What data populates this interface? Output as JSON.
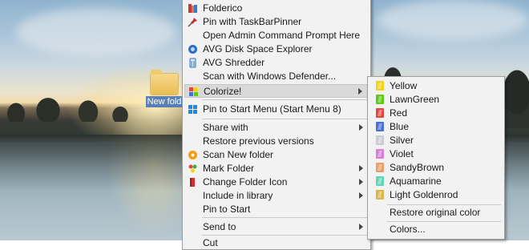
{
  "desktop": {
    "icon_label": "New fold"
  },
  "context_menu": {
    "items": [
      {
        "label": "Folderico",
        "icon": "folderico-icon",
        "icon_color": "#c23b3b"
      },
      {
        "label": "Pin with TaskBarPinner",
        "icon": "pin-icon",
        "icon_color": "#cc2a2a"
      },
      {
        "label": "Open Admin Command Prompt Here",
        "icon": "",
        "icon_color": ""
      },
      {
        "label": "AVG Disk Space Explorer",
        "icon": "avg-disk-icon",
        "icon_color": "#2a6fc9"
      },
      {
        "label": "AVG Shredder",
        "icon": "avg-shredder-icon",
        "icon_color": "#2a6fc9"
      },
      {
        "label": "Scan with Windows Defender...",
        "icon": "",
        "icon_color": ""
      },
      {
        "label": "Colorize!",
        "icon": "colorize-icon",
        "icon_color": "#e09a3a",
        "submenu": true,
        "highlighted": true
      },
      {
        "label": "Pin to Start Menu (Start Menu 8)",
        "icon": "windows-logo-icon",
        "icon_color": "#1e88e5"
      },
      {
        "label": "Share with",
        "icon": "",
        "icon_color": "",
        "submenu": true
      },
      {
        "label": "Restore previous versions",
        "icon": "",
        "icon_color": ""
      },
      {
        "label": "Scan New folder",
        "icon": "avast-icon",
        "icon_color": "#f39c12"
      },
      {
        "label": "Mark Folder",
        "icon": "mark-folder-icon",
        "icon_color": "#3fae49",
        "submenu": true
      },
      {
        "label": "Change Folder Icon",
        "icon": "change-folder-icon",
        "icon_color": "#d32f2f",
        "submenu": true
      },
      {
        "label": "Include in library",
        "icon": "",
        "icon_color": "",
        "submenu": true
      },
      {
        "label": "Pin to Start",
        "icon": "",
        "icon_color": ""
      },
      {
        "label": "Send to",
        "icon": "",
        "icon_color": "",
        "submenu": true
      },
      {
        "label": "Cut",
        "icon": "",
        "icon_color": ""
      }
    ]
  },
  "colorize_submenu": {
    "colors": [
      {
        "label": "Yellow",
        "color": "#f2d21b"
      },
      {
        "label": "LawnGreen",
        "color": "#5fc918"
      },
      {
        "label": "Red",
        "color": "#e0473f"
      },
      {
        "label": "Blue",
        "color": "#4a6fd6"
      },
      {
        "label": "Silver",
        "color": "#c9ccd1"
      },
      {
        "label": "Violet",
        "color": "#d77fd6"
      },
      {
        "label": "SandyBrown",
        "color": "#e8a066"
      },
      {
        "label": "Aquamarine",
        "color": "#5fd6b3"
      },
      {
        "label": "Light Goldenrod",
        "color": "#d7b64e"
      }
    ],
    "restore_label": "Restore original color",
    "colors_label": "Colors..."
  }
}
